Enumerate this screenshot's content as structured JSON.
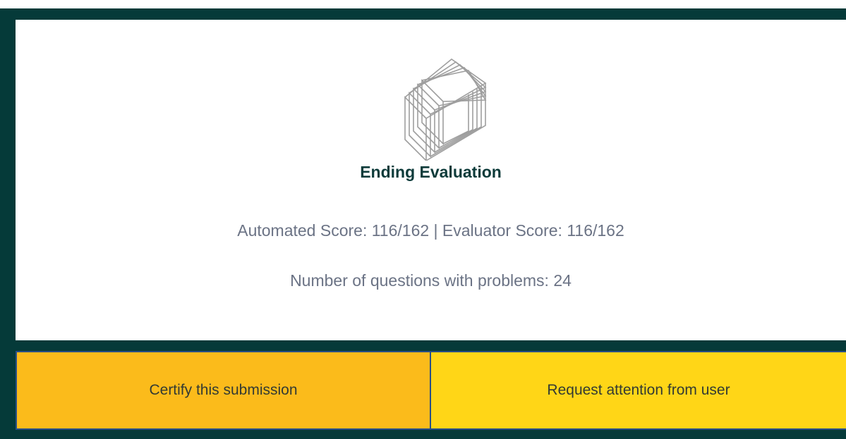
{
  "evaluation": {
    "title": "Ending Evaluation",
    "score_line": "Automated Score: 116/162 | Evaluator Score: 116/162",
    "problems_line": "Number of questions with problems: 24"
  },
  "actions": {
    "certify_label": "Certify this submission",
    "request_label": "Request attention from user"
  },
  "icons": {
    "logo": "stacked-cube-lines-logo"
  },
  "colors": {
    "background": "#053a39",
    "certify_button": "#fbbb1b",
    "request_button": "#ffd617",
    "title": "#0d3b3a",
    "muted_text": "#6b7385"
  }
}
